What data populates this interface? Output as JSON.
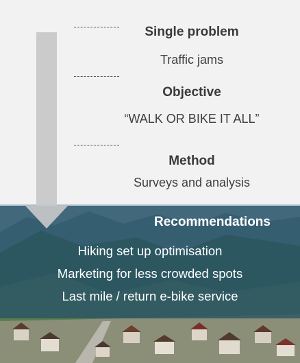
{
  "steps": [
    {
      "heading": "Single problem",
      "body": "Traffic jams"
    },
    {
      "heading": "Objective",
      "body": "“WALK OR BIKE IT ALL”"
    },
    {
      "heading": "Method",
      "body": "Surveys and analysis"
    }
  ],
  "recommendations": {
    "title": "Recommendations",
    "items": [
      "Hiking set up optimisation",
      "Marketing for less crowded spots",
      "Last mile / return e-bike service"
    ]
  },
  "colors": {
    "arrow": "#c8c8c8",
    "panel_background": "#f2f2f2",
    "overlay": "#285268"
  }
}
